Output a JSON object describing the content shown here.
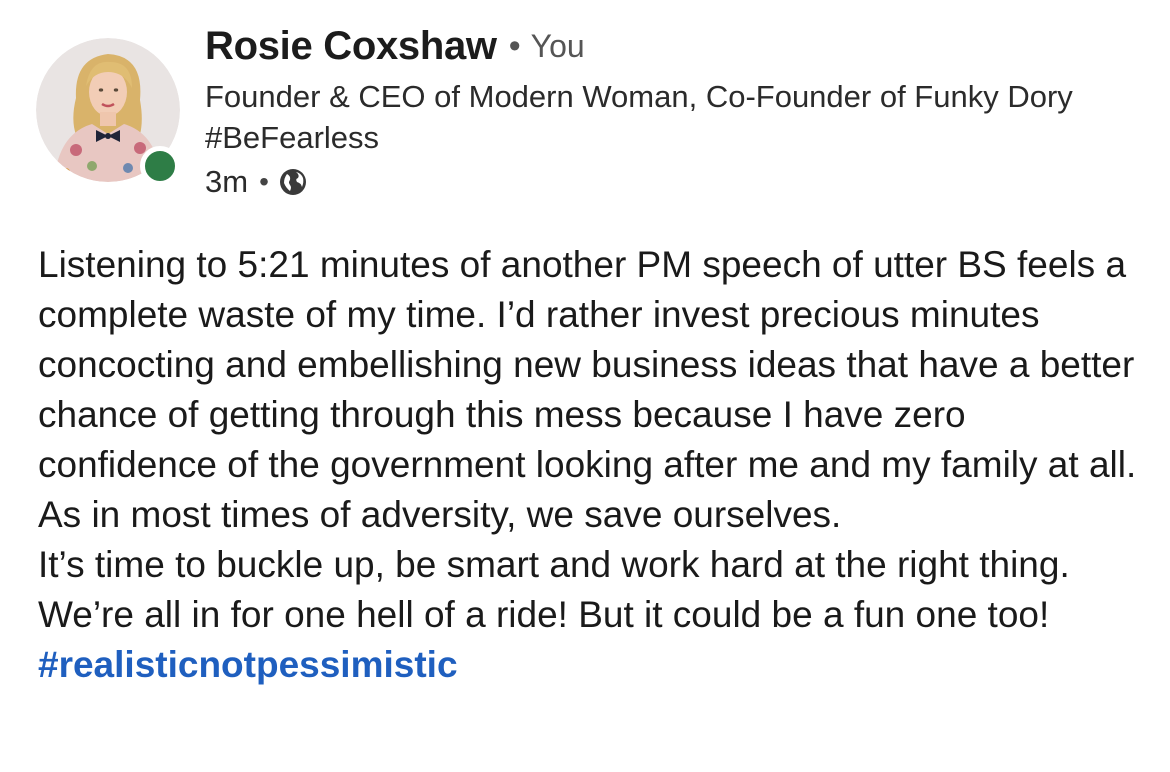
{
  "post": {
    "author": {
      "name": "Rosie Coxshaw",
      "relation": "You",
      "headline": "Founder & CEO of Modern Woman, Co-Founder of Funky Dory #BeFearless",
      "online": true
    },
    "meta": {
      "time": "3m",
      "visibility_icon": "globe-icon"
    },
    "body": {
      "lines": [
        "Listening to 5:21 minutes of another PM speech of utter BS feels a complete waste of my time. I’d rather invest precious minutes concocting and embellishing new business ideas that have a better chance of getting through this mess because I have zero confidence of the government looking after me and my family at all.",
        "As in most times of adversity, we save ourselves.",
        "It’s time to buckle up, be smart and work hard at the right thing. We’re all in for one hell of a ride! But it could be a fun one too! "
      ],
      "hashtag": "#realisticnotpessimistic"
    },
    "colors": {
      "hashtag": "#1f5fbf",
      "online_dot": "#2e7d46"
    }
  }
}
